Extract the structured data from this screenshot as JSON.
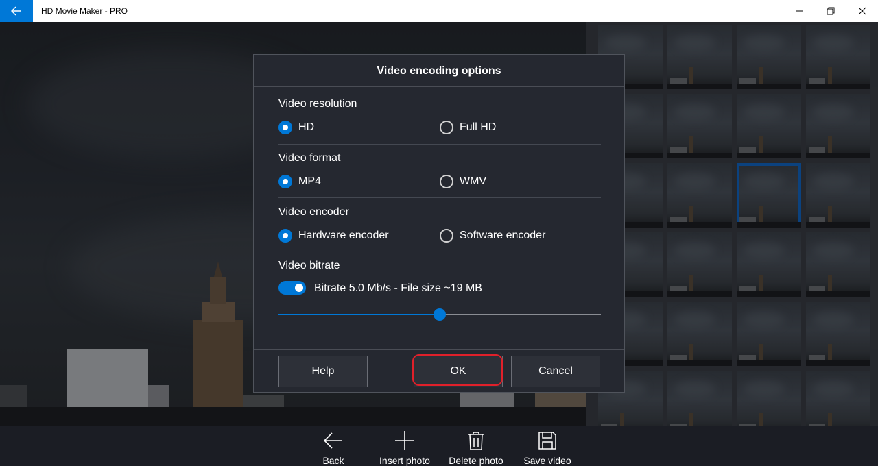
{
  "titlebar": {
    "title": "HD Movie Maker - PRO"
  },
  "dialog": {
    "title": "Video encoding options",
    "sections": {
      "resolution": {
        "label": "Video resolution",
        "options": [
          "HD",
          "Full HD"
        ],
        "selected": "HD"
      },
      "format": {
        "label": "Video format",
        "options": [
          "MP4",
          "WMV"
        ],
        "selected": "MP4"
      },
      "encoder": {
        "label": "Video encoder",
        "options": [
          "Hardware encoder",
          "Software encoder"
        ],
        "selected": "Hardware encoder"
      },
      "bitrate": {
        "label": "Video bitrate",
        "toggle_on": true,
        "text": "Bitrate 5.0 Mb/s - File size ~19 MB",
        "slider_fraction": 0.5
      }
    },
    "buttons": {
      "help": "Help",
      "ok": "OK",
      "cancel": "Cancel"
    }
  },
  "toolbar": {
    "back": "Back",
    "insert": "Insert photo",
    "delete": "Delete photo",
    "save": "Save video"
  },
  "colors": {
    "accent": "#0078d7",
    "highlight": "#e0202a",
    "selected_thumb": "#1266c4"
  }
}
